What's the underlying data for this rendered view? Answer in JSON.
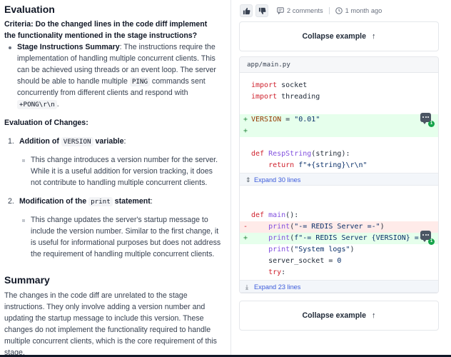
{
  "evaluation": {
    "title": "Evaluation",
    "criteria": "Criteria: Do the changed lines in the code diff implement the functionality mentioned in the stage instructions?",
    "stage_label": "Stage Instructions Summary",
    "stage_text_1": ": The instructions require the implementation of handling multiple concurrent clients. This can be achieved using threads or an event loop. The server should be able to handle multiple ",
    "stage_code_ping": "PING",
    "stage_text_2": " commands sent concurrently from different clients and respond with ",
    "stage_code_pong": "+PONG\\r\\n",
    "stage_text_3": ".",
    "changes_heading": "Evaluation of Changes:",
    "items": [
      {
        "number": "1.",
        "title_pre": "Addition of ",
        "title_code": "VERSION",
        "title_post": " variable",
        "title_colon": ":",
        "text": "This change introduces a version number for the server. While it is a useful addition for version tracking, it does not contribute to handling multiple concurrent clients."
      },
      {
        "number": "2.",
        "title_pre": "Modification of the ",
        "title_code": "print",
        "title_post": " statement",
        "title_colon": ":",
        "text": "This change updates the server's startup message to include the version number. Similar to the first change, it is useful for informational purposes but does not address the requirement of handling multiple concurrent clients."
      }
    ]
  },
  "summary": {
    "title": "Summary",
    "text": "The changes in the code diff are unrelated to the stage instructions. They only involve adding a version number and updating the startup message to include this version. These changes do not implement the functionality required to handle multiple concurrent clients, which is the core requirement of this stage."
  },
  "review_panel": {
    "thumbs_up_icon": "thumbs-up-icon",
    "thumbs_down_icon": "thumbs-down-icon",
    "comments_label": "2 comments",
    "time_label": "1 month ago",
    "collapse_label": "Collapse example",
    "file_name": "app/main.py",
    "expand_top": "Expand 30 lines",
    "expand_bottom": "Expand 23 lines",
    "comment_badge_count": "1",
    "code": {
      "l1a": "import",
      "l1b": " socket",
      "l2a": "import",
      "l2b": " threading",
      "l3a": "VERSION",
      "l3b": " = ",
      "l3c": "\"0.01\"",
      "l4a": "def",
      "l4b": " RespString",
      "l4c": "(string):",
      "l5a": "    return",
      "l5b": " f\"+{string}\\r\\n\"",
      "l6a": "def",
      "l6b": " main",
      "l6c": "():",
      "l7a": "    print",
      "l7b": "(",
      "l7c": "\"-= REDIS Server =-\"",
      "l7d": ")",
      "l8a": "    print",
      "l8b": "(",
      "l8c": "f\"-= REDIS Server {VERSION} =-\"",
      "l8d": ")",
      "l9a": "    print",
      "l9b": "(",
      "l9c": "\"System logs\"",
      "l9d": ")",
      "l10a": "    server_socket",
      "l10b": " = ",
      "l10c": "0",
      "l11a": "    try",
      "l11b": ":"
    }
  },
  "colors": {
    "added_bg": "#e6ffec",
    "removed_bg": "#ffebe9",
    "badge_green": "#16a34a"
  }
}
